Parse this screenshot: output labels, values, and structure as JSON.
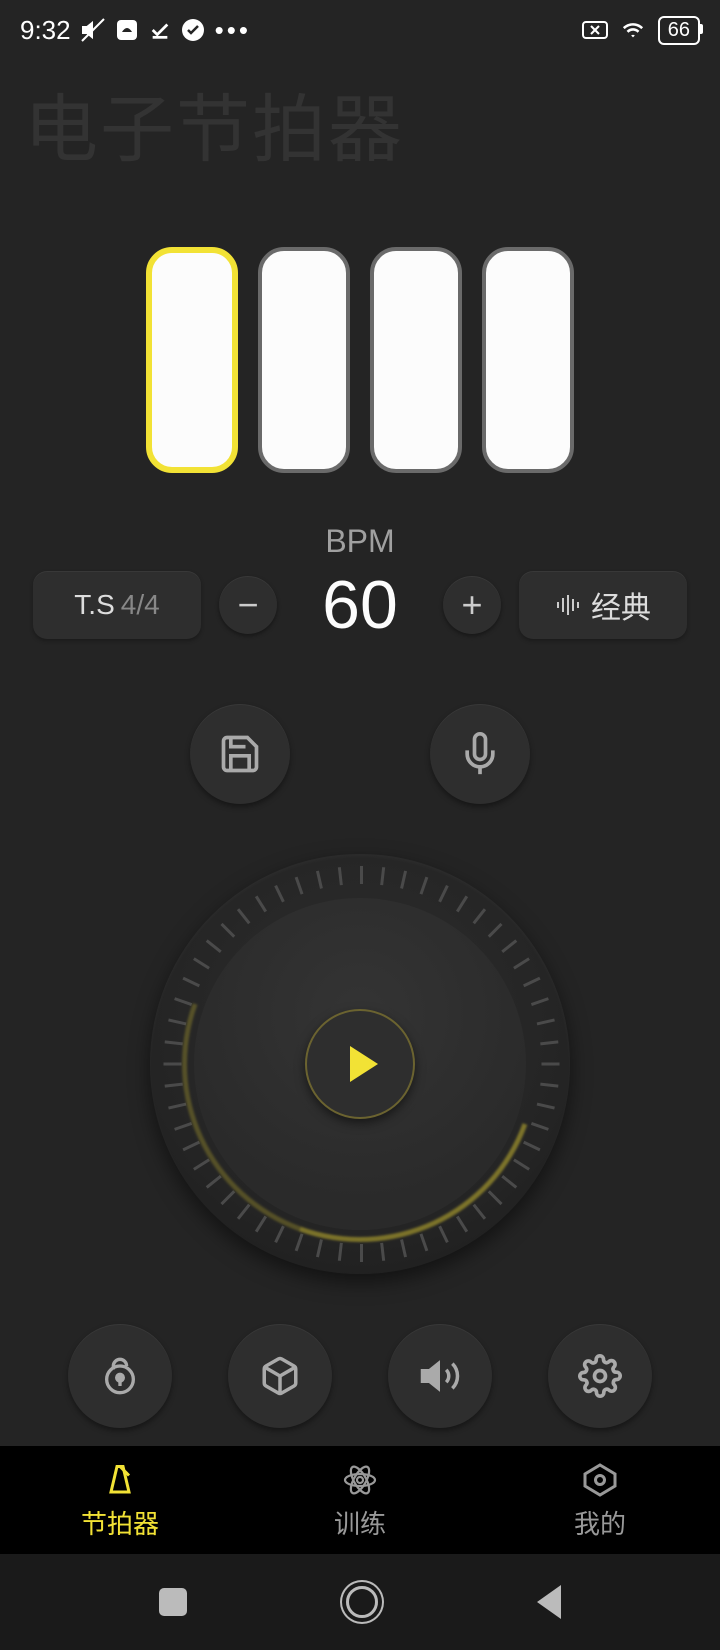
{
  "status": {
    "time": "9:32",
    "battery": "66"
  },
  "app": {
    "title": "电子节拍器"
  },
  "bpm": {
    "label": "BPM",
    "value": "60"
  },
  "timeSignature": {
    "label": "T.S",
    "value": "4/4"
  },
  "sound": {
    "label": "经典"
  },
  "tabs": {
    "metronome": "节拍器",
    "training": "训练",
    "mine": "我的"
  }
}
